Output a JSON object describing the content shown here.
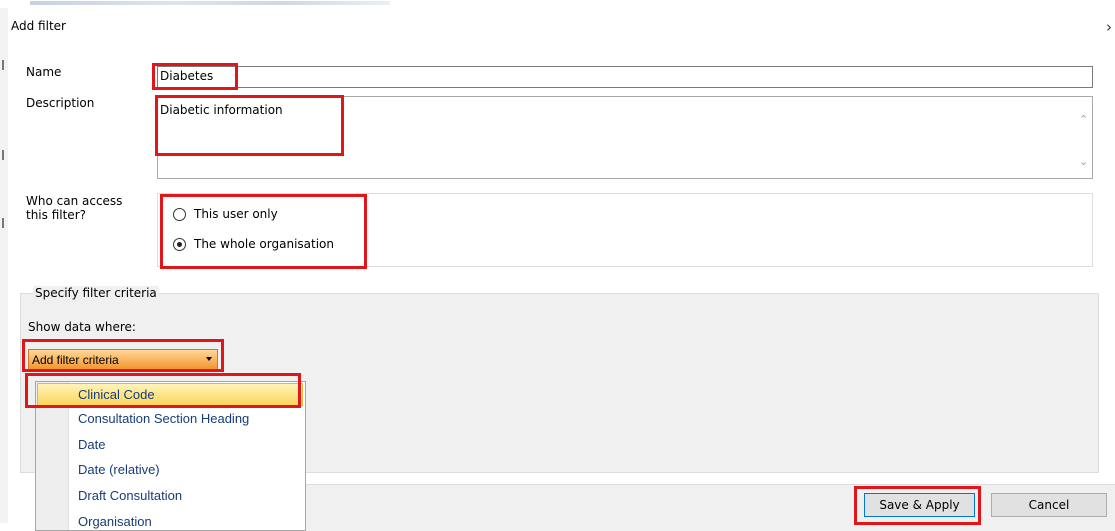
{
  "dialog": {
    "title": "Add filter",
    "close_glyph": "›"
  },
  "form": {
    "name_label": "Name",
    "name_value": "Diabetes",
    "description_label": "Description",
    "description_value": "Diabetic information",
    "access_label_line1": "Who can access",
    "access_label_line2": "this filter?",
    "access_options": [
      {
        "label": "This user only",
        "checked": false
      },
      {
        "label": "The whole organisation",
        "checked": true
      }
    ]
  },
  "criteria": {
    "group_title": "Specify filter criteria",
    "show_label": "Show data where:",
    "add_button_label": "Add filter criteria",
    "dropdown_items": [
      "Clinical Code",
      "Consultation Section Heading",
      "Date",
      "Date (relative)",
      "Draft Consultation",
      "Organisation"
    ],
    "highlighted_item": "Clinical Code"
  },
  "footer": {
    "save_label": "Save & Apply",
    "cancel_label": "Cancel"
  },
  "colors": {
    "annotation": "#e0161b",
    "dropdown_text": "#173c7a",
    "button_orange": "#f3902f"
  }
}
